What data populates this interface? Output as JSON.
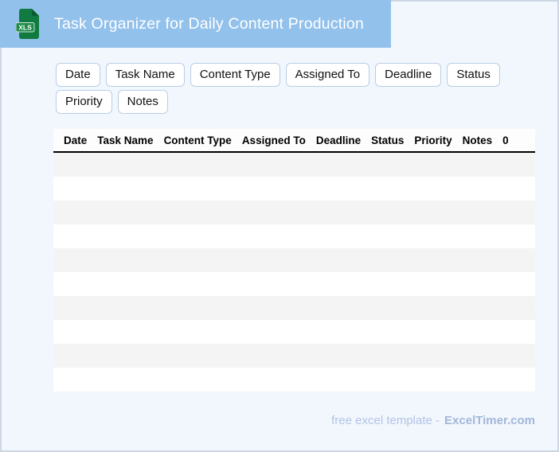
{
  "header": {
    "title": "Task Organizer for Daily Content Production",
    "icon_label": "XLS"
  },
  "chips": [
    "Date",
    "Task Name",
    "Content Type",
    "Assigned To",
    "Deadline",
    "Status",
    "Priority",
    "Notes"
  ],
  "table": {
    "columns": [
      "Date",
      "Task Name",
      "Content Type",
      "Assigned To",
      "Deadline",
      "Status",
      "Priority",
      "Notes",
      "0"
    ],
    "rows": [
      "",
      "",
      "",
      "",
      "",
      "",
      "",
      "",
      "",
      ""
    ]
  },
  "footer": {
    "text": "free excel template -",
    "brand": "ExcelTimer.com"
  },
  "colors": {
    "header_bg": "#92c1ec",
    "icon_green": "#117a41",
    "icon_fold_green": "#0a5c30",
    "badge_green": "#1d8c4a",
    "page_bg": "#f1f7fd",
    "frame_border": "#ccd7e3",
    "chip_border": "#b9cde7",
    "stripe_gray": "#f4f4f5",
    "stripe_white": "#ffffff",
    "header_border": "#000000",
    "footer_text": "#b4c3e6",
    "footer_brand": "#a3b6da"
  }
}
